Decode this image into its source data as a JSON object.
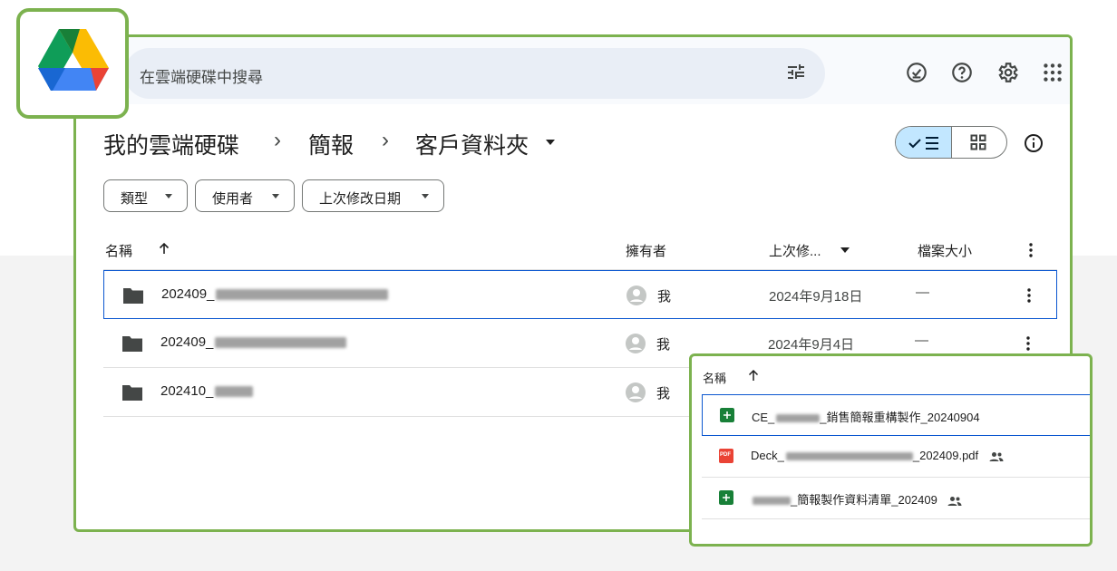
{
  "search": {
    "placeholder": "在雲端硬碟中搜尋"
  },
  "top_icons": [
    "offline-check-icon",
    "help-icon",
    "settings-icon",
    "apps-icon"
  ],
  "breadcrumb": {
    "items": [
      "我的雲端硬碟",
      "簡報",
      "客戶資料夾"
    ],
    "separator": "›"
  },
  "filters": [
    {
      "label": "類型"
    },
    {
      "label": "使用者"
    },
    {
      "label": "上次修改日期"
    }
  ],
  "columns": {
    "name": "名稱",
    "owner": "擁有者",
    "modified": "上次修...",
    "size": "檔案大小"
  },
  "rows": [
    {
      "name": "202409_",
      "owner": "我",
      "modified": "2024年9月18日",
      "size": "—"
    },
    {
      "name": "202409_",
      "owner": "我",
      "modified": "2024年9月4日",
      "size": "—"
    },
    {
      "name": "202410_",
      "owner": "我",
      "modified": "",
      "size": ""
    }
  ],
  "popup": {
    "header": "名稱",
    "files": [
      {
        "prefix": "CE_",
        "suffix": "_銷售簡報重構製作_20240904",
        "type": "sheets"
      },
      {
        "prefix": "Deck_",
        "suffix": "_202409.pdf",
        "type": "pdf",
        "pdf_label": "PDF"
      },
      {
        "prefix": "",
        "suffix": "_簡報製作資料清單_202409",
        "type": "sheets"
      }
    ]
  },
  "colors": {
    "accent_green": "#7cb24f",
    "selection_blue": "#0b57d0",
    "toggle_bg": "#c2e7ff",
    "sheets_green": "#188038",
    "pdf_red": "#ea4335"
  }
}
